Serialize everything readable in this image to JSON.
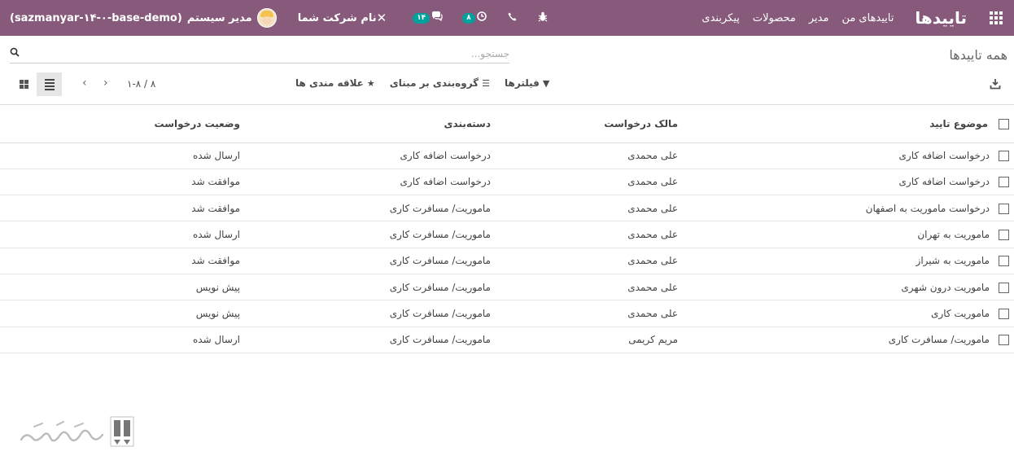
{
  "navbar": {
    "brand": "تاییدها",
    "menu": [
      "تاییدهای من",
      "مدیر",
      "محصولات",
      "پیکربندی"
    ],
    "user_name": "مدیر سیستم",
    "db_name": "(sazmanyar-۱۴-۰-base-demo)",
    "company": "نام شرکت شما",
    "messages_count": "۱۴",
    "activities_count": "۸",
    "accent_color": "#875a7b"
  },
  "breadcrumb": "همه تاییدها",
  "search": {
    "placeholder": "جستجو..."
  },
  "toolbar": {
    "filters": "فیلترها",
    "group_by": "گروه‌بندی بر مبنای",
    "favorites": "علاقه مندی ها"
  },
  "pager": {
    "range": "۱-۸ / ۸"
  },
  "table": {
    "columns": [
      "موضوع تایید",
      "مالک درخواست",
      "دسته‌بندی",
      "وضعیت درخواست"
    ],
    "rows": [
      {
        "subject": "درخواست اضافه کاری",
        "owner": "علی محمدی",
        "category": "درخواست اضافه کاری",
        "state": "ارسال شده"
      },
      {
        "subject": "درخواست اضافه کاری",
        "owner": "علی محمدی",
        "category": "درخواست اضافه کاری",
        "state": "موافقت شد"
      },
      {
        "subject": "درخواست ماموریت به اصفهان",
        "owner": "علی محمدی",
        "category": "ماموریت/ مسافرت کاری",
        "state": "موافقت شد"
      },
      {
        "subject": "ماموریت به تهران",
        "owner": "علی محمدی",
        "category": "ماموریت/ مسافرت کاری",
        "state": "ارسال شده"
      },
      {
        "subject": "ماموریت به شیراز",
        "owner": "علی محمدی",
        "category": "ماموریت/ مسافرت کاری",
        "state": "موافقت شد"
      },
      {
        "subject": "ماموریت درون شهری",
        "owner": "علی محمدی",
        "category": "ماموریت/ مسافرت کاری",
        "state": "پیش نویس"
      },
      {
        "subject": "ماموریت کاری",
        "owner": "علی محمدی",
        "category": "ماموریت/ مسافرت کاری",
        "state": "پیش نویس"
      },
      {
        "subject": "ماموریت/ مسافرت کاری",
        "owner": "مریم کریمی",
        "category": "ماموریت/ مسافرت کاری",
        "state": "ارسال شده"
      }
    ]
  }
}
